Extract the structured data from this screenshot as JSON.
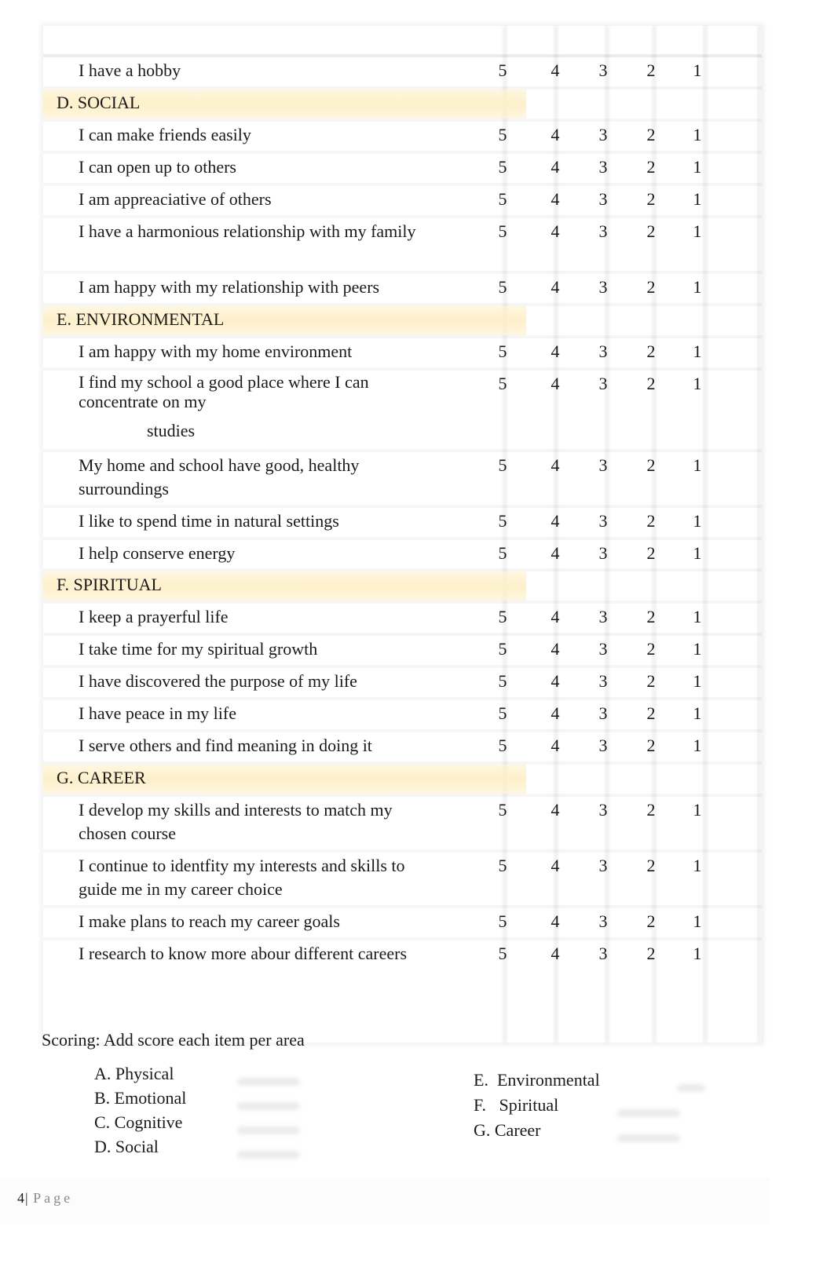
{
  "scale": [
    "5",
    "4",
    "3",
    "2",
    "1"
  ],
  "rows": [
    {
      "type": "item",
      "label": "I have a hobby"
    },
    {
      "type": "section",
      "label": "D. SOCIAL"
    },
    {
      "type": "item",
      "label": "I can make friends easily"
    },
    {
      "type": "item",
      "label": "I can open up to others"
    },
    {
      "type": "item",
      "label": "I am appreaciative of others"
    },
    {
      "type": "item",
      "label": "I have a harmonious relationship with my family"
    },
    {
      "type": "item",
      "label": "I am happy with my relationship with peers"
    },
    {
      "type": "section",
      "label": "E.  ENVIRONMENTAL"
    },
    {
      "type": "item",
      "label": "I am happy with my home environment"
    },
    {
      "type": "item",
      "label": "I find my school a good place where I can concentrate on my",
      "extra": "studies"
    },
    {
      "type": "item",
      "label": "My home and school have good, healthy surroundings"
    },
    {
      "type": "item",
      "label": "I like to spend time in natural settings"
    },
    {
      "type": "item",
      "label": "I help conserve energy"
    },
    {
      "type": "section",
      "label": "F.  SPIRITUAL"
    },
    {
      "type": "item",
      "label": "I keep a prayerful life"
    },
    {
      "type": "item",
      "label": "I take time for my spiritual growth"
    },
    {
      "type": "item",
      "label": "I have discovered the purpose of my life"
    },
    {
      "type": "item",
      "label": "I have peace in my life"
    },
    {
      "type": "item",
      "label": "I serve others and find meaning in doing it"
    },
    {
      "type": "section",
      "label": "G. CAREER"
    },
    {
      "type": "item",
      "label": "I develop my skills and interests to match my chosen course"
    },
    {
      "type": "item",
      "label": "I continue to identfity my interests and skills to guide me in my career choice"
    },
    {
      "type": "item",
      "label": "I make plans to reach my career goals"
    },
    {
      "type": "item",
      "label": "I research to know more abour different careers"
    }
  ],
  "scoring": {
    "title": "Scoring: Add score each item per area",
    "left_areas": [
      "A. Physical",
      "B. Emotional",
      "C. Cognitive",
      "D. Social"
    ],
    "right_areas": [
      "E.  Environmental",
      "F.   Spiritual",
      "G. Career"
    ]
  },
  "footer": {
    "page_number": "4",
    "separator": "|",
    "page_label": "Page"
  },
  "colors": {
    "section_highlight": "#fdeec4",
    "text": "#1a1a1a",
    "page_label": "#8a8a8a"
  }
}
